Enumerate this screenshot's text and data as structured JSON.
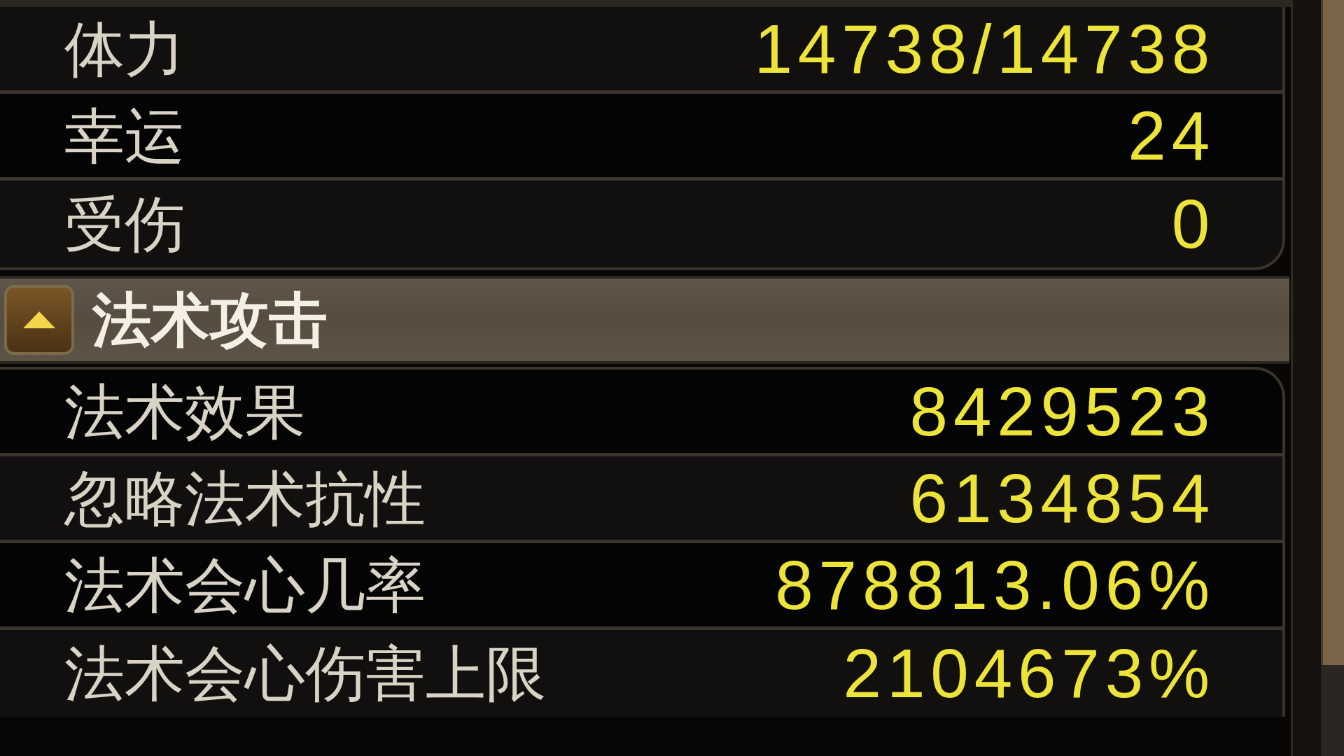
{
  "sections": [
    {
      "rows": [
        {
          "label": "体力",
          "value": "14738/14738"
        },
        {
          "label": "幸运",
          "value": "24"
        },
        {
          "label": "受伤",
          "value": "0"
        }
      ]
    },
    {
      "header": {
        "title": "法术攻击",
        "expanded": true
      },
      "rows": [
        {
          "label": "法术效果",
          "value": "8429523"
        },
        {
          "label": "忽略法术抗性",
          "value": "6134854"
        },
        {
          "label": "法术会心几率",
          "value": "878813.06%"
        },
        {
          "label": "法术会心伤害上限",
          "value": "2104673%"
        }
      ]
    }
  ]
}
